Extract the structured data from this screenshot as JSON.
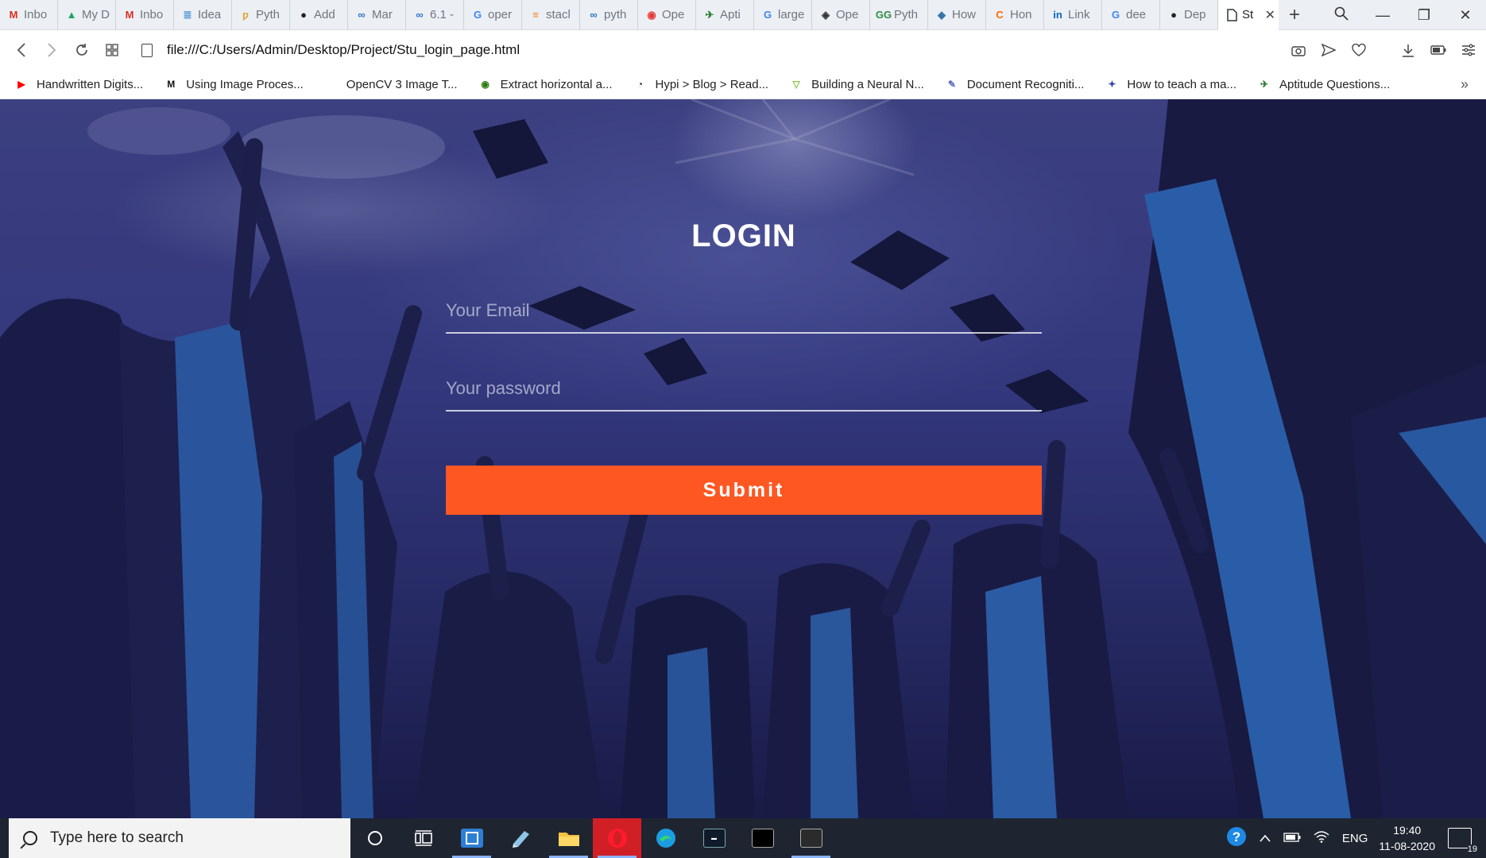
{
  "browser": {
    "tabs": [
      {
        "icon": "gmail-icon",
        "title": "Inbo",
        "color": "#d93025",
        "glyph": "M"
      },
      {
        "icon": "google-drive-icon",
        "title": "My D",
        "color": "#1fa463",
        "glyph": "▲"
      },
      {
        "icon": "gmail-icon",
        "title": "Inbo",
        "color": "#d93025",
        "glyph": "M"
      },
      {
        "icon": "ideas-icon",
        "title": "Idea",
        "color": "#4a90d9",
        "glyph": "≣"
      },
      {
        "icon": "python-doc-icon",
        "title": "Pyth",
        "color": "#e2a33b",
        "glyph": "ƿ"
      },
      {
        "icon": "github-icon",
        "title": "Add",
        "color": "#222222",
        "glyph": "●"
      },
      {
        "icon": "coursera-icon",
        "title": "Mar",
        "color": "#2a73cc",
        "glyph": "∞"
      },
      {
        "icon": "coursera-icon",
        "title": "6.1 -",
        "color": "#2a73cc",
        "glyph": "∞"
      },
      {
        "icon": "google-icon",
        "title": "oper",
        "color": "#4285f4",
        "glyph": "G"
      },
      {
        "icon": "stackoverflow-icon",
        "title": "stacl",
        "color": "#f48024",
        "glyph": "≡"
      },
      {
        "icon": "coursera-icon",
        "title": "pyth",
        "color": "#2a73cc",
        "glyph": "∞"
      },
      {
        "icon": "opencv-icon",
        "title": "Ope",
        "color": "#e53935",
        "glyph": "◉"
      },
      {
        "icon": "aptitude-icon",
        "title": "Apti",
        "color": "#2e7d32",
        "glyph": "✈"
      },
      {
        "icon": "google-icon",
        "title": "large",
        "color": "#4285f4",
        "glyph": "G"
      },
      {
        "icon": "opencv-diamond-icon",
        "title": "Ope",
        "color": "#333333",
        "glyph": "◈"
      },
      {
        "icon": "geeksforgeeks-icon",
        "title": "Pyth",
        "color": "#2f8d46",
        "glyph": "GG"
      },
      {
        "icon": "python-icon",
        "title": "How",
        "color": "#3776ab",
        "glyph": "◆"
      },
      {
        "icon": "hackerrank-icon",
        "title": "Hon",
        "color": "#ff6a00",
        "glyph": "C"
      },
      {
        "icon": "linkedin-icon",
        "title": "Link",
        "color": "#0a66c2",
        "glyph": "in"
      },
      {
        "icon": "google-icon",
        "title": "dee",
        "color": "#4285f4",
        "glyph": "G"
      },
      {
        "icon": "github-icon",
        "title": "Dep",
        "color": "#222222",
        "glyph": "●"
      }
    ],
    "active_tab": {
      "icon": "page-icon",
      "title": "St"
    },
    "new_tab_label": "+",
    "url": "file:///C:/Users/Admin/Desktop/Project/Stu_login_page.html",
    "bookmarks": [
      {
        "icon": "youtube-icon",
        "label": "Handwritten Digits...",
        "color": "#ff0000",
        "glyph": "▶"
      },
      {
        "icon": "medium-icon",
        "label": "Using Image Proces...",
        "color": "#111111",
        "glyph": "M"
      },
      {
        "icon": "blank-icon",
        "label": "OpenCV 3 Image T...",
        "color": "#ffffff",
        "glyph": ""
      },
      {
        "icon": "pyimagesearch-icon",
        "label": "Extract horizontal a...",
        "color": "#2b7a0b",
        "glyph": "◉"
      },
      {
        "icon": "hypi-icon",
        "label": "Hypi > Blog > Read...",
        "color": "#222222",
        "glyph": "◔"
      },
      {
        "icon": "neural-net-icon",
        "label": "Building a Neural N...",
        "color": "#8bc34a",
        "glyph": "▽"
      },
      {
        "icon": "document-recognition-icon",
        "label": "Document Recogniti...",
        "color": "#5c6bc0",
        "glyph": "✎"
      },
      {
        "icon": "robot-icon",
        "label": "How to teach a ma...",
        "color": "#3949ab",
        "glyph": "✦"
      },
      {
        "icon": "aptitude-icon",
        "label": "Aptitude Questions...",
        "color": "#2e7d32",
        "glyph": "✈"
      }
    ]
  },
  "page": {
    "title": "LOGIN",
    "email_placeholder": "Your Email",
    "password_placeholder": "Your password",
    "submit_label": "Submit",
    "accent_color": "#ff5722"
  },
  "taskbar": {
    "search_placeholder": "Type here to search",
    "language": "ENG",
    "time": "19:40",
    "date": "11-08-2020",
    "notification_count": "19"
  }
}
